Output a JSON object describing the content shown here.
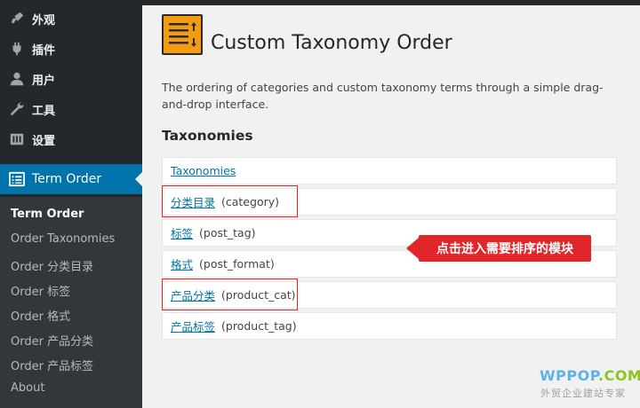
{
  "sidebar": {
    "menu": [
      {
        "label": "外观",
        "icon": "paintbrush-icon"
      },
      {
        "label": "插件",
        "icon": "plugins-icon"
      },
      {
        "label": "用户",
        "icon": "users-icon"
      },
      {
        "label": "工具",
        "icon": "tools-icon"
      },
      {
        "label": "设置",
        "icon": "settings-icon"
      }
    ],
    "current": {
      "label": "Term Order",
      "icon": "list-icon"
    },
    "submenu": [
      "Term Order",
      "Order Taxonomies",
      "Order 分类目录",
      "Order 标签",
      "Order 格式",
      "Order 产品分类",
      "Order 产品标签",
      "About"
    ]
  },
  "page": {
    "title": "Custom Taxonomy Order",
    "description": "The ordering of categories and custom taxonomy terms through a simple drag-and-drop interface.",
    "section_title": "Taxonomies"
  },
  "taxonomies": [
    {
      "name": "Taxonomies",
      "slug": ""
    },
    {
      "name": "分类目录",
      "slug": "(category)"
    },
    {
      "name": "标签",
      "slug": "(post_tag)"
    },
    {
      "name": "格式",
      "slug": "(post_format)"
    },
    {
      "name": "产品分类",
      "slug": "(product_cat)"
    },
    {
      "name": "产品标签",
      "slug": "(product_tag)"
    }
  ],
  "callout": {
    "text": "点击进入需要排序的模块"
  },
  "watermark": {
    "brand_a": "WPPOP",
    "brand_b": ".COM",
    "tagline": "外贸企业建站专家"
  },
  "colors": {
    "sidebar_bg": "#23282d",
    "submenu_bg": "#32373c",
    "accent": "#0073aa",
    "highlight": "#e0262b",
    "icon_bg": "#f39c12"
  }
}
